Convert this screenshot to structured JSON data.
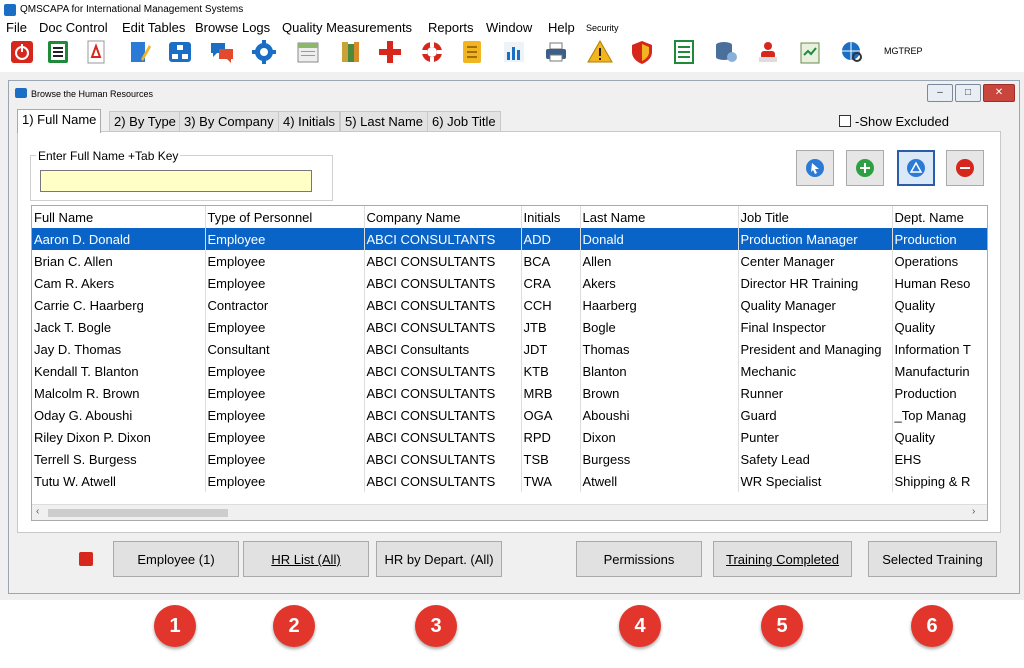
{
  "app": {
    "title": "QMSCAPA for International Management Systems"
  },
  "menu": [
    "File",
    "Doc Control",
    "Edit Tables",
    "Browse Logs",
    "Quality Measurements",
    "Reports",
    "Window",
    "Help",
    "Security"
  ],
  "toolbar": {
    "label": "MGTREP",
    "icons": [
      "power-icon",
      "document-list-icon",
      "pdf-icon",
      "pen-icon",
      "org-chart-icon",
      "chat-icon",
      "gear-icon",
      "calendar-icon",
      "books-icon",
      "red-cross-icon",
      "lifebuoy-icon",
      "notebook-icon",
      "bar-chart-icon",
      "printer-icon",
      "warning-icon",
      "shield-icon",
      "checklist-icon",
      "database-icon",
      "users-icon",
      "clipboard-icon",
      "globe-search-icon"
    ]
  },
  "window": {
    "title": "Browse the Human Resources",
    "tabs": [
      "1) Full Name",
      "2) By Type",
      "3) By Company",
      "4) Initials",
      "5) Last Name",
      "6) Job Title"
    ],
    "active_tab": 0,
    "show_excluded_label": "-Show Excluded",
    "search_label": "Enter Full Name +Tab Key",
    "search_value": ""
  },
  "grid": {
    "columns": [
      "Full Name",
      "Type of Personnel",
      "Company Name",
      "Initials",
      "Last Name",
      "Job Title",
      "Dept. Name"
    ],
    "rows": [
      [
        "Aaron D. Donald",
        "Employee",
        "ABCI CONSULTANTS",
        "ADD",
        "Donald",
        "Production Manager",
        "Production"
      ],
      [
        "Brian C. Allen",
        "Employee",
        "ABCI CONSULTANTS",
        "BCA",
        "Allen",
        "Center Manager",
        "Operations"
      ],
      [
        "Cam R. Akers",
        "Employee",
        "ABCI CONSULTANTS",
        "CRA",
        "Akers",
        "Director HR Training",
        "Human Reso"
      ],
      [
        "Carrie C. Haarberg",
        "Contractor",
        "ABCI CONSULTANTS",
        "CCH",
        "Haarberg",
        "Quality Manager",
        "Quality"
      ],
      [
        "Jack T. Bogle",
        "Employee",
        "ABCI CONSULTANTS",
        "JTB",
        "Bogle",
        "Final Inspector",
        "Quality"
      ],
      [
        "Jay D. Thomas",
        "Consultant",
        "ABCI Consultants",
        "JDT",
        "Thomas",
        "President and Managing",
        "Information T"
      ],
      [
        "Kendall T. Blanton",
        "Employee",
        "ABCI CONSULTANTS",
        "KTB",
        "Blanton",
        "Mechanic",
        "Manufacturin"
      ],
      [
        "Malcolm R. Brown",
        "Employee",
        "ABCI CONSULTANTS",
        "MRB",
        "Brown",
        "Runner",
        "Production"
      ],
      [
        "Oday G. Aboushi",
        "Employee",
        "ABCI CONSULTANTS",
        "OGA",
        "Aboushi",
        "Guard",
        "_Top Manag"
      ],
      [
        "Riley Dixon P. Dixon",
        "Employee",
        "ABCI CONSULTANTS",
        "RPD",
        "Dixon",
        "Punter",
        "Quality"
      ],
      [
        "Terrell S. Burgess",
        "Employee",
        "ABCI CONSULTANTS",
        "TSB",
        "Burgess",
        "Safety Lead",
        "EHS"
      ],
      [
        "Tutu W. Atwell",
        "Employee",
        "ABCI CONSULTANTS",
        "TWA",
        "Atwell",
        "WR Specialist",
        "Shipping & R"
      ]
    ],
    "selected_row": 0
  },
  "bottom_buttons": [
    "Employee (1)",
    "HR List (All)",
    "HR by Depart. (All)",
    "Permissions",
    "Training Completed",
    "Selected Training"
  ],
  "callouts": [
    "1",
    "2",
    "3",
    "4",
    "5",
    "6"
  ],
  "colors": {
    "selection": "#0a64c8",
    "input_bg": "#ffffc6",
    "callout": "#e2352b"
  }
}
